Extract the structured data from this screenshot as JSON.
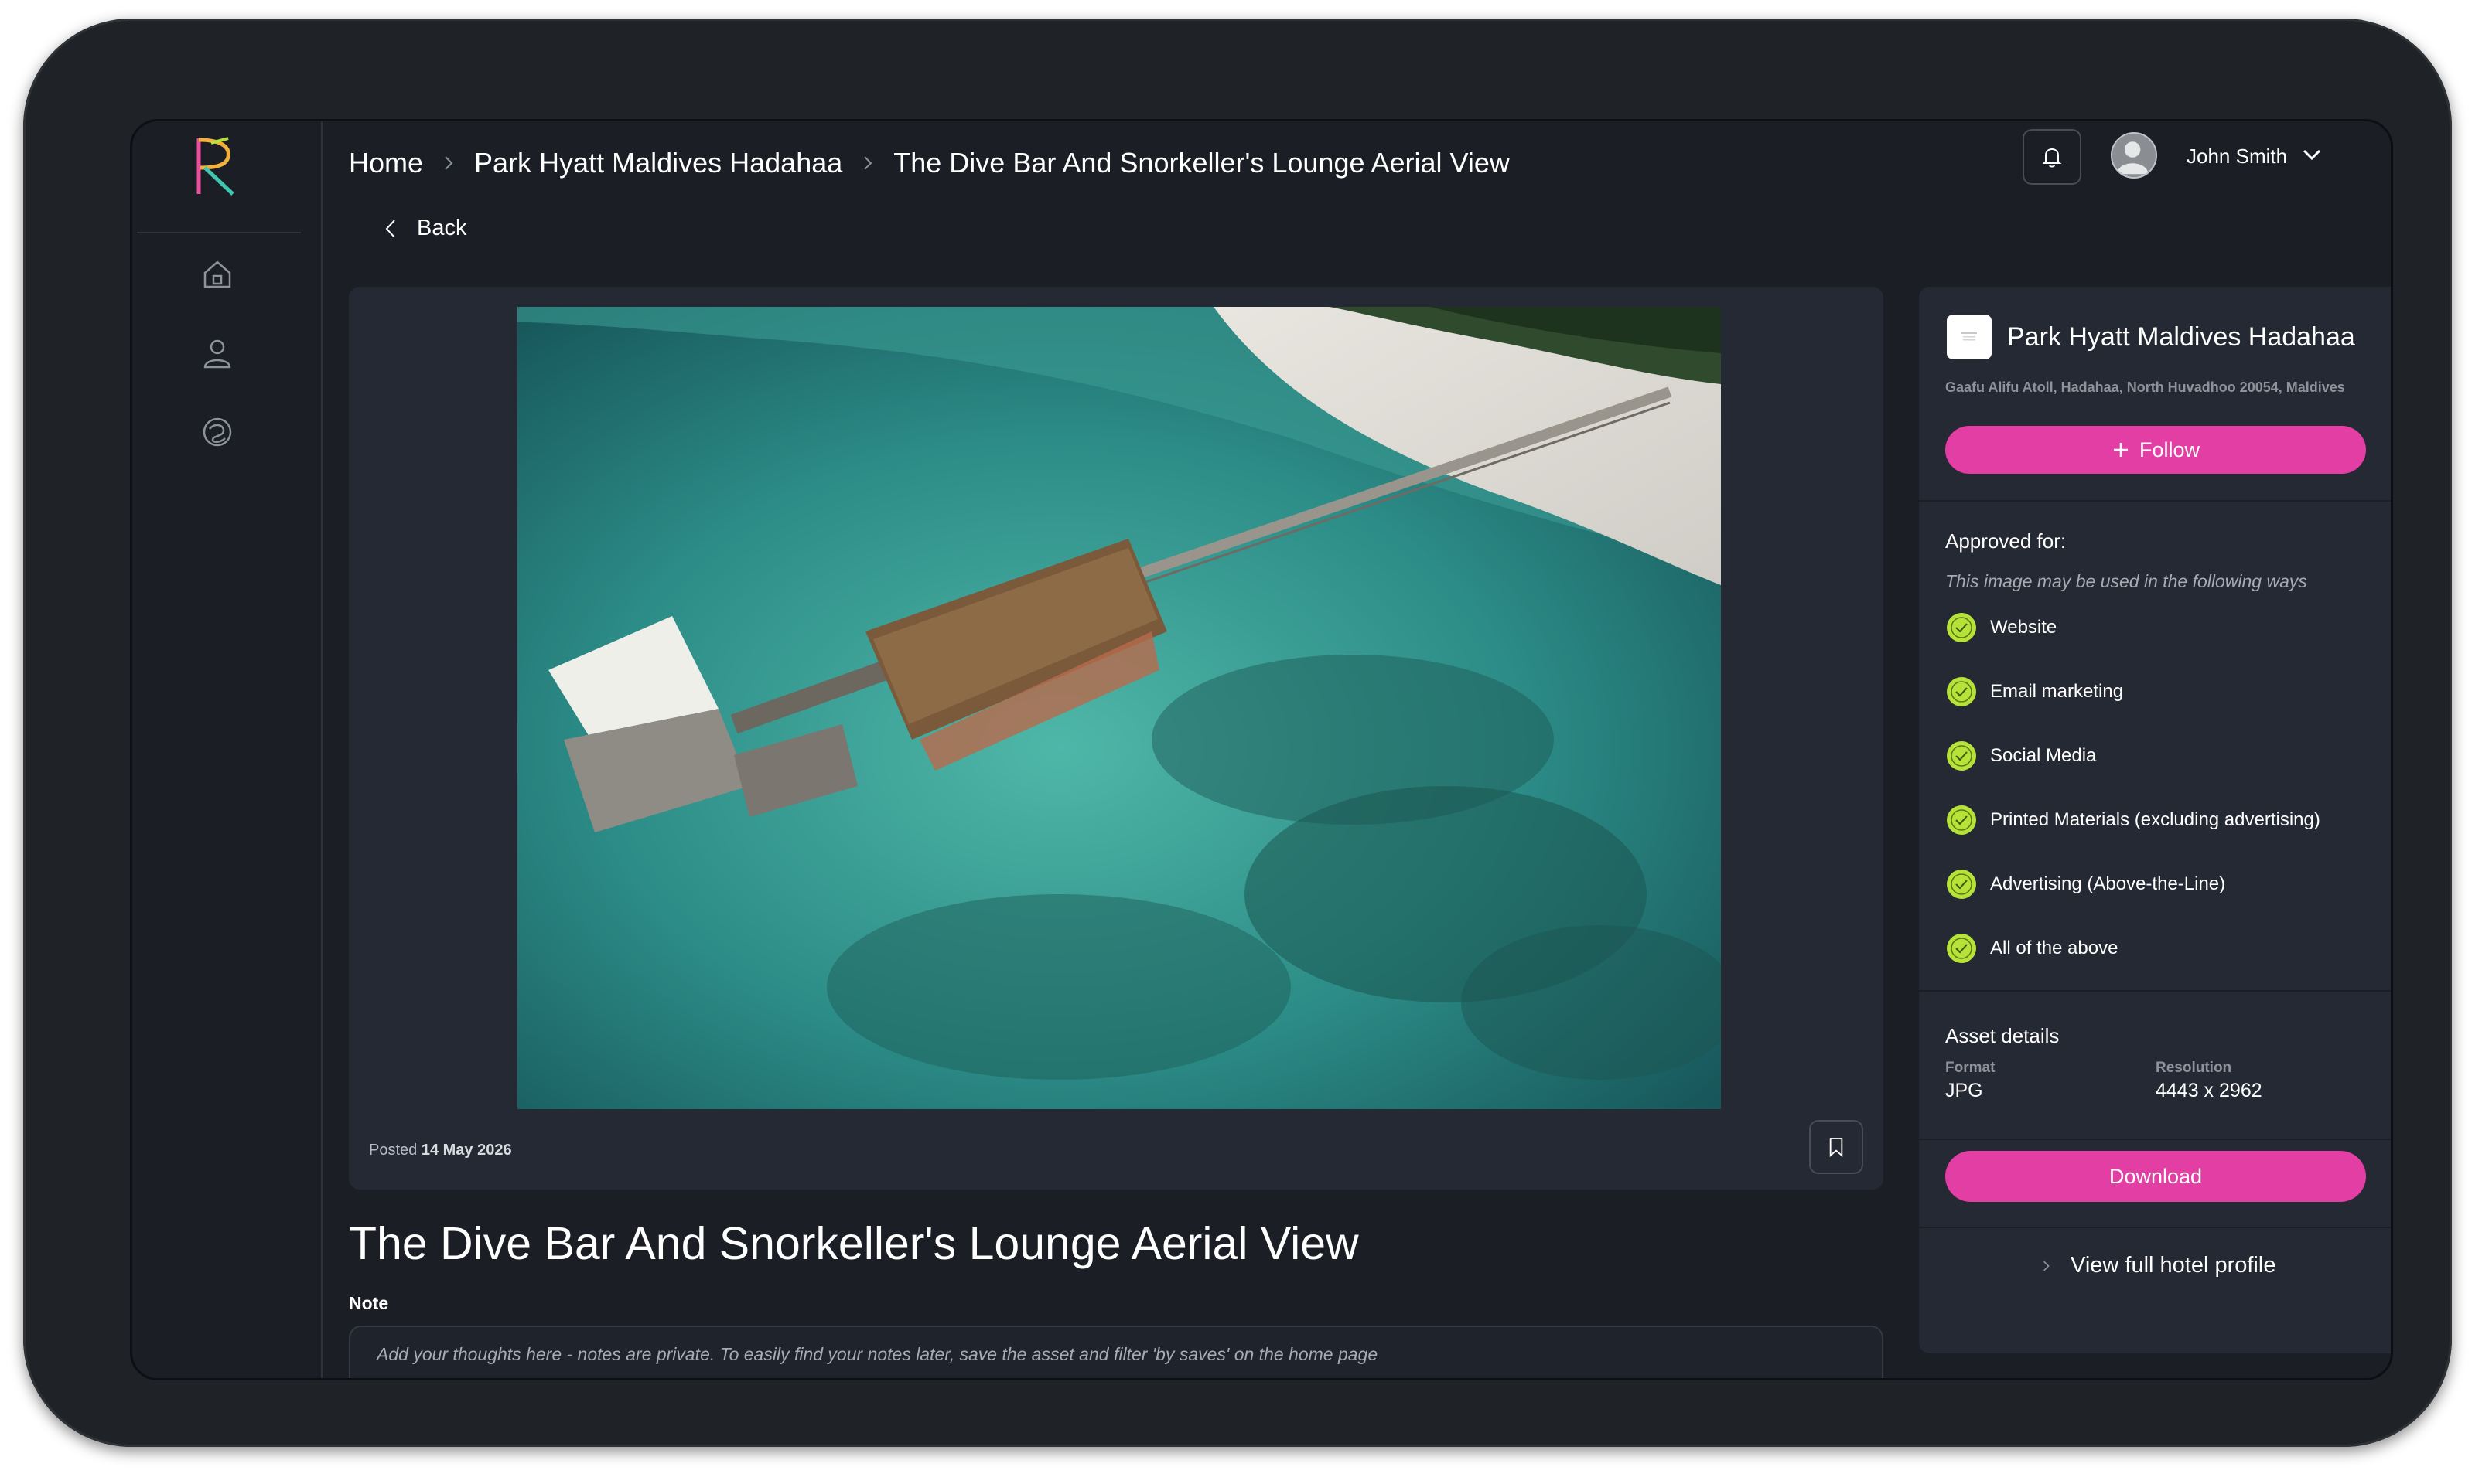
{
  "breadcrumb": {
    "items": [
      "Home",
      "Park Hyatt Maldives Hadahaa",
      "The Dive Bar And Snorkeller's Lounge Aerial View"
    ]
  },
  "header": {
    "user_name": "John Smith"
  },
  "nav": {
    "back_label": "Back",
    "icons": [
      "home-icon",
      "user-icon",
      "explore-icon"
    ]
  },
  "asset": {
    "posted_prefix": "Posted",
    "posted_date": "14 May 2026",
    "title": "The Dive Bar And Snorkeller's Lounge Aerial View",
    "note_label": "Note",
    "note_placeholder": "Add your thoughts here - notes are private. To easily find your notes later, save the asset and filter 'by saves' on the home page"
  },
  "hotel": {
    "name": "Park Hyatt Maldives Hadahaa",
    "address": "Gaafu Alifu Atoll, Hadahaa, North Huvadhoo 20054, Maldives",
    "follow_label": "Follow"
  },
  "approved": {
    "title": "Approved for:",
    "subtitle": "This image may be used in the following ways",
    "items": [
      "Website",
      "Email marketing",
      "Social Media",
      "Printed Materials (excluding advertising)",
      "Advertising (Above-the-Line)",
      "All of the above"
    ]
  },
  "asset_details": {
    "title": "Asset details",
    "format_label": "Format",
    "format_value": "JPG",
    "resolution_label": "Resolution",
    "resolution_value": "4443 x 2962"
  },
  "actions": {
    "download_label": "Download",
    "profile_link_label": "View full hotel profile"
  },
  "colors": {
    "accent": "#e23ea3",
    "check": "#b6e23a",
    "background": "#1b1e25",
    "card": "#252933"
  }
}
